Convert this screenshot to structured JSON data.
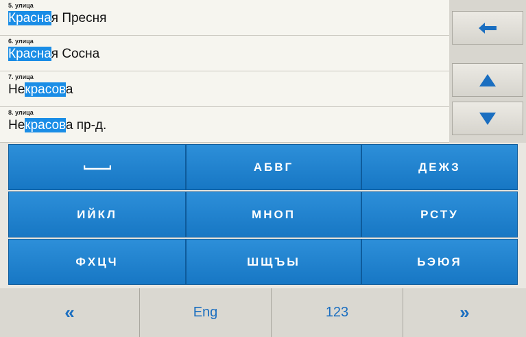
{
  "results": [
    {
      "category": "5. улица",
      "pre": "",
      "match": "Красна",
      "post": "я Пресня"
    },
    {
      "category": "6. улица",
      "pre": "",
      "match": "Красна",
      "post": "я Сосна"
    },
    {
      "category": "7. улица",
      "pre": "Не",
      "match": "красов",
      "post": "а"
    },
    {
      "category": "8. улица",
      "pre": "Не",
      "match": "красов",
      "post": "а пр-д."
    }
  ],
  "side": {
    "backspace_icon": "arrow-left-icon",
    "up_icon": "triangle-up-icon",
    "down_icon": "triangle-down-icon"
  },
  "keyboard": {
    "rows": [
      [
        "",
        "АБВГ",
        "ДЕЖЗ"
      ],
      [
        "ИЙКЛ",
        "МНОП",
        "РСТУ"
      ],
      [
        "ФХЦЧ",
        "ШЩЪЫ",
        "ЬЭЮЯ"
      ]
    ],
    "space_icon": "space-bar-icon"
  },
  "bottom": {
    "prev": "«",
    "lang": "Eng",
    "numbers": "123",
    "next": "»"
  },
  "colors": {
    "accent": "#1a8de6",
    "key": "#1777c4",
    "link": "#1a6ec0"
  }
}
